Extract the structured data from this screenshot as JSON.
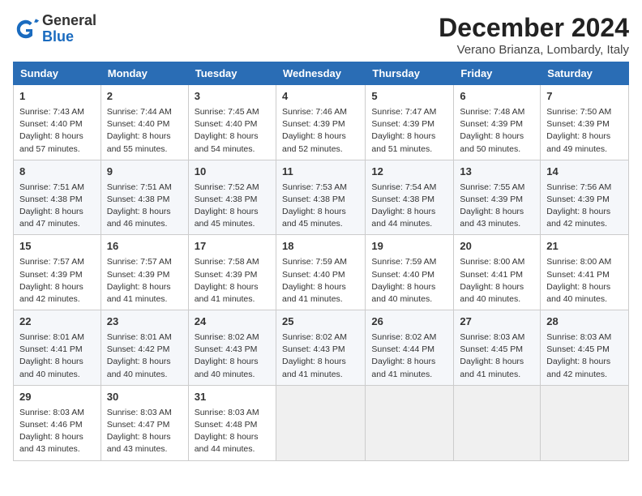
{
  "header": {
    "logo_general": "General",
    "logo_blue": "Blue",
    "month_title": "December 2024",
    "location": "Verano Brianza, Lombardy, Italy"
  },
  "weekdays": [
    "Sunday",
    "Monday",
    "Tuesday",
    "Wednesday",
    "Thursday",
    "Friday",
    "Saturday"
  ],
  "weeks": [
    [
      {
        "day": "1",
        "sunrise": "Sunrise: 7:43 AM",
        "sunset": "Sunset: 4:40 PM",
        "daylight": "Daylight: 8 hours and 57 minutes."
      },
      {
        "day": "2",
        "sunrise": "Sunrise: 7:44 AM",
        "sunset": "Sunset: 4:40 PM",
        "daylight": "Daylight: 8 hours and 55 minutes."
      },
      {
        "day": "3",
        "sunrise": "Sunrise: 7:45 AM",
        "sunset": "Sunset: 4:40 PM",
        "daylight": "Daylight: 8 hours and 54 minutes."
      },
      {
        "day": "4",
        "sunrise": "Sunrise: 7:46 AM",
        "sunset": "Sunset: 4:39 PM",
        "daylight": "Daylight: 8 hours and 52 minutes."
      },
      {
        "day": "5",
        "sunrise": "Sunrise: 7:47 AM",
        "sunset": "Sunset: 4:39 PM",
        "daylight": "Daylight: 8 hours and 51 minutes."
      },
      {
        "day": "6",
        "sunrise": "Sunrise: 7:48 AM",
        "sunset": "Sunset: 4:39 PM",
        "daylight": "Daylight: 8 hours and 50 minutes."
      },
      {
        "day": "7",
        "sunrise": "Sunrise: 7:50 AM",
        "sunset": "Sunset: 4:39 PM",
        "daylight": "Daylight: 8 hours and 49 minutes."
      }
    ],
    [
      {
        "day": "8",
        "sunrise": "Sunrise: 7:51 AM",
        "sunset": "Sunset: 4:38 PM",
        "daylight": "Daylight: 8 hours and 47 minutes."
      },
      {
        "day": "9",
        "sunrise": "Sunrise: 7:51 AM",
        "sunset": "Sunset: 4:38 PM",
        "daylight": "Daylight: 8 hours and 46 minutes."
      },
      {
        "day": "10",
        "sunrise": "Sunrise: 7:52 AM",
        "sunset": "Sunset: 4:38 PM",
        "daylight": "Daylight: 8 hours and 45 minutes."
      },
      {
        "day": "11",
        "sunrise": "Sunrise: 7:53 AM",
        "sunset": "Sunset: 4:38 PM",
        "daylight": "Daylight: 8 hours and 45 minutes."
      },
      {
        "day": "12",
        "sunrise": "Sunrise: 7:54 AM",
        "sunset": "Sunset: 4:38 PM",
        "daylight": "Daylight: 8 hours and 44 minutes."
      },
      {
        "day": "13",
        "sunrise": "Sunrise: 7:55 AM",
        "sunset": "Sunset: 4:39 PM",
        "daylight": "Daylight: 8 hours and 43 minutes."
      },
      {
        "day": "14",
        "sunrise": "Sunrise: 7:56 AM",
        "sunset": "Sunset: 4:39 PM",
        "daylight": "Daylight: 8 hours and 42 minutes."
      }
    ],
    [
      {
        "day": "15",
        "sunrise": "Sunrise: 7:57 AM",
        "sunset": "Sunset: 4:39 PM",
        "daylight": "Daylight: 8 hours and 42 minutes."
      },
      {
        "day": "16",
        "sunrise": "Sunrise: 7:57 AM",
        "sunset": "Sunset: 4:39 PM",
        "daylight": "Daylight: 8 hours and 41 minutes."
      },
      {
        "day": "17",
        "sunrise": "Sunrise: 7:58 AM",
        "sunset": "Sunset: 4:39 PM",
        "daylight": "Daylight: 8 hours and 41 minutes."
      },
      {
        "day": "18",
        "sunrise": "Sunrise: 7:59 AM",
        "sunset": "Sunset: 4:40 PM",
        "daylight": "Daylight: 8 hours and 41 minutes."
      },
      {
        "day": "19",
        "sunrise": "Sunrise: 7:59 AM",
        "sunset": "Sunset: 4:40 PM",
        "daylight": "Daylight: 8 hours and 40 minutes."
      },
      {
        "day": "20",
        "sunrise": "Sunrise: 8:00 AM",
        "sunset": "Sunset: 4:41 PM",
        "daylight": "Daylight: 8 hours and 40 minutes."
      },
      {
        "day": "21",
        "sunrise": "Sunrise: 8:00 AM",
        "sunset": "Sunset: 4:41 PM",
        "daylight": "Daylight: 8 hours and 40 minutes."
      }
    ],
    [
      {
        "day": "22",
        "sunrise": "Sunrise: 8:01 AM",
        "sunset": "Sunset: 4:41 PM",
        "daylight": "Daylight: 8 hours and 40 minutes."
      },
      {
        "day": "23",
        "sunrise": "Sunrise: 8:01 AM",
        "sunset": "Sunset: 4:42 PM",
        "daylight": "Daylight: 8 hours and 40 minutes."
      },
      {
        "day": "24",
        "sunrise": "Sunrise: 8:02 AM",
        "sunset": "Sunset: 4:43 PM",
        "daylight": "Daylight: 8 hours and 40 minutes."
      },
      {
        "day": "25",
        "sunrise": "Sunrise: 8:02 AM",
        "sunset": "Sunset: 4:43 PM",
        "daylight": "Daylight: 8 hours and 41 minutes."
      },
      {
        "day": "26",
        "sunrise": "Sunrise: 8:02 AM",
        "sunset": "Sunset: 4:44 PM",
        "daylight": "Daylight: 8 hours and 41 minutes."
      },
      {
        "day": "27",
        "sunrise": "Sunrise: 8:03 AM",
        "sunset": "Sunset: 4:45 PM",
        "daylight": "Daylight: 8 hours and 41 minutes."
      },
      {
        "day": "28",
        "sunrise": "Sunrise: 8:03 AM",
        "sunset": "Sunset: 4:45 PM",
        "daylight": "Daylight: 8 hours and 42 minutes."
      }
    ],
    [
      {
        "day": "29",
        "sunrise": "Sunrise: 8:03 AM",
        "sunset": "Sunset: 4:46 PM",
        "daylight": "Daylight: 8 hours and 43 minutes."
      },
      {
        "day": "30",
        "sunrise": "Sunrise: 8:03 AM",
        "sunset": "Sunset: 4:47 PM",
        "daylight": "Daylight: 8 hours and 43 minutes."
      },
      {
        "day": "31",
        "sunrise": "Sunrise: 8:03 AM",
        "sunset": "Sunset: 4:48 PM",
        "daylight": "Daylight: 8 hours and 44 minutes."
      },
      null,
      null,
      null,
      null
    ]
  ]
}
